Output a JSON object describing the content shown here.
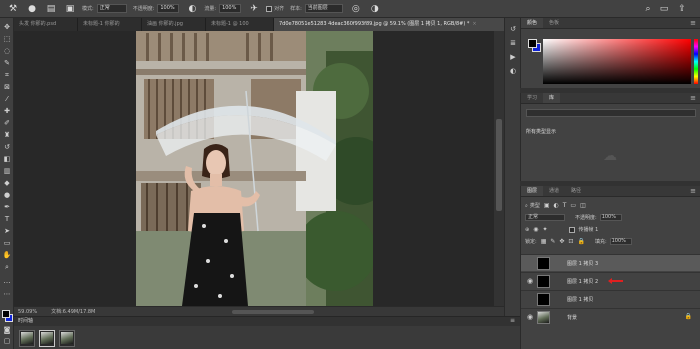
{
  "options_bar": {
    "mode_label": "模式:",
    "mode_value": "正常",
    "opacity_label": "不透明度:",
    "opacity_value": "100%",
    "flow_label": "流量:",
    "flow_value": "100%",
    "smoothing_label": "对齐",
    "sample_label": "样本:",
    "sample_value": "当前图层"
  },
  "tabs": [
    {
      "label": "头发 你那的.psd",
      "active": false
    },
    {
      "label": "未标题-1 你那的",
      "active": false
    },
    {
      "label": "油画 你那的.jpg",
      "active": false
    },
    {
      "label": "未标题-1 @ 100",
      "active": false
    },
    {
      "label": "7d0e78051e51283 4deac360f993f89.jpg @ 59.1% (图层 1 拷贝 1, RGB/8#) *",
      "active": true
    }
  ],
  "status_bar": {
    "zoom": "59.09%",
    "doc_info": "文档:6.49M/17.8M"
  },
  "timeline": {
    "title": "时间轴",
    "frame_count": 3
  },
  "color_panel": {
    "tabs": [
      "颜色",
      "色板"
    ],
    "foreground": "#000000",
    "background": "#1024d8"
  },
  "libraries_panel": {
    "tabs": [
      "学习",
      "库"
    ],
    "select_label": "所有类型显示"
  },
  "layers_panel": {
    "tabs": [
      "图层",
      "通道",
      "路径"
    ],
    "filter_label": "类型",
    "blend_mode": "正常",
    "opacity_label": "不透明度:",
    "opacity_value": "100%",
    "lock_label": "锁定:",
    "fill_label": "填充:",
    "fill_value": "100%",
    "propagate_label": "传播帧 1",
    "layers": [
      {
        "name": "图层 1 拷贝 3",
        "visible": false,
        "selected": true,
        "thumb": "black"
      },
      {
        "name": "图层 1 拷贝 2",
        "visible": true,
        "selected": false,
        "thumb": "black"
      },
      {
        "name": "图层 1 拷贝",
        "visible": false,
        "selected": false,
        "thumb": "black"
      },
      {
        "name": "背景",
        "visible": true,
        "selected": false,
        "thumb": "photo"
      }
    ]
  }
}
